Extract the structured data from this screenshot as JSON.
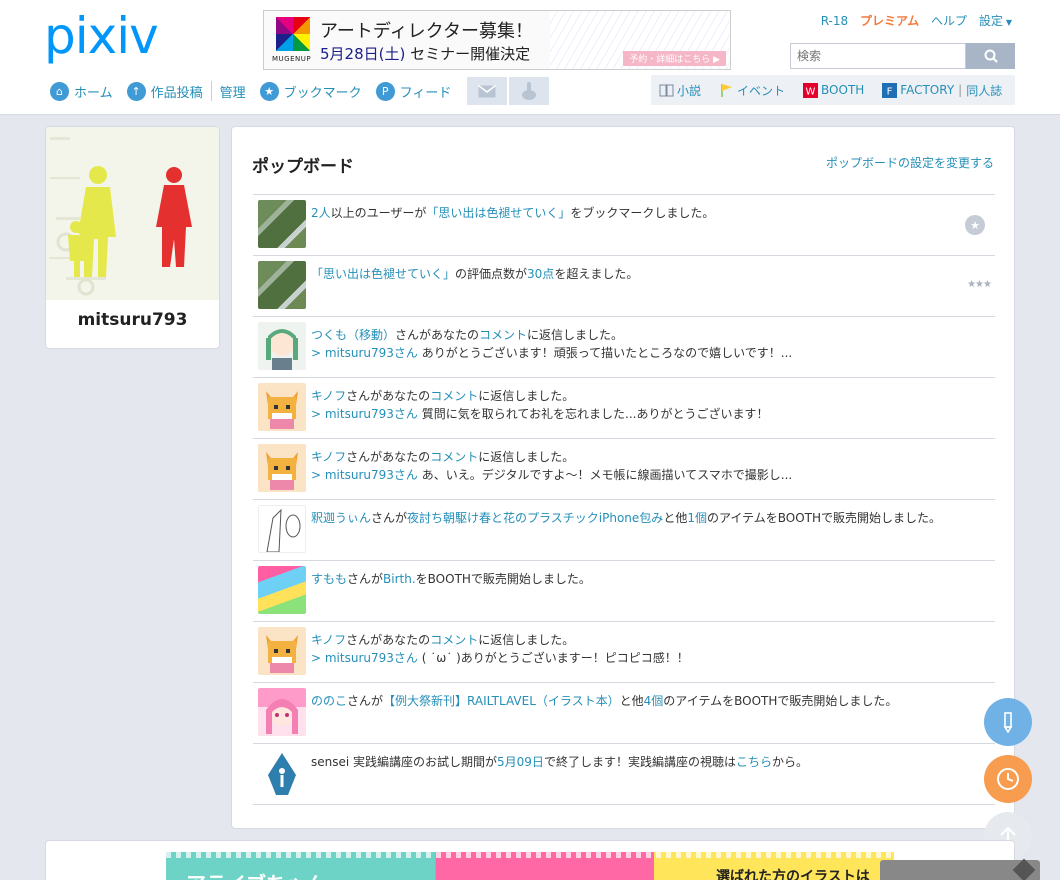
{
  "header": {
    "logo": "pixiv",
    "banner": {
      "brand": "MUGENUP",
      "title": "アートディレクター募集！",
      "date": "5月28日(土)",
      "subtitle": "セミナー開催決定",
      "cta": "予約・詳細はこちら ▶"
    },
    "toplinks": {
      "r18": "R-18",
      "premium": "プレミアム",
      "help": "ヘルプ",
      "settings": "設定"
    },
    "search": {
      "placeholder": "検索"
    },
    "nav": [
      {
        "label": "ホーム"
      },
      {
        "label": "作品投稿"
      },
      {
        "label": "管理"
      },
      {
        "label": "ブックマーク"
      },
      {
        "label": "フィード"
      }
    ],
    "rightnav": {
      "novel": "小説",
      "event": "イベント",
      "booth": "BOOTH",
      "factory": "FACTORY",
      "doujinshi": "同人誌"
    }
  },
  "profile": {
    "username": "mitsuru793"
  },
  "popboard": {
    "title": "ポップボード",
    "settings_link": "ポップボードの設定を変更する",
    "items": [
      {
        "l1a": "2人",
        "l1b": "以上のユーザーが",
        "l1c": "「思い出は色褪せていく」",
        "l1d": "をブックマークしました。"
      },
      {
        "l1a": "「思い出は色褪せていく」",
        "l1b": "の評価点数が",
        "l1c": "30点",
        "l1d": "を超えました。"
      },
      {
        "l1a": "つくも（移動）",
        "l1b": "さんがあなたの",
        "l1c": "コメント",
        "l1d": "に返信しました。",
        "l2a": "> mitsuru793さん",
        "l2b": " ありがとうございます！頑張って描いたところなので嬉しいです！..."
      },
      {
        "l1a": "キノフ",
        "l1b": "さんがあなたの",
        "l1c": "コメント",
        "l1d": "に返信しました。",
        "l2a": "> mitsuru793さん",
        "l2b": " 質問に気を取られてお礼を忘れました...ありがとうございます！"
      },
      {
        "l1a": "キノフ",
        "l1b": "さんがあなたの",
        "l1c": "コメント",
        "l1d": "に返信しました。",
        "l2a": "> mitsuru793さん",
        "l2b": " あ、いえ。デジタルですよ〜！メモ帳に線画描いてスマホで撮影し..."
      },
      {
        "l1a": "釈迦うぃん",
        "l1b": "さんが",
        "l1c": "夜討ち朝駆け春と花のプラスチックiPhone包み",
        "l1d": "と他",
        "l1e": "1個",
        "l1f": "のアイテムをBOOTHで販売開始しました。"
      },
      {
        "l1a": "すもも",
        "l1b": "さんが",
        "l1c": "Birth.",
        "l1d": "をBOOTHで販売開始しました。"
      },
      {
        "l1a": "キノフ",
        "l1b": "さんがあなたの",
        "l1c": "コメント",
        "l1d": "に返信しました。",
        "l2a": "> mitsuru793さん",
        "l2b": " ( ˙ω˙ )ありがとうございますー！ピコピコ感！！"
      },
      {
        "l1a": "ののこ",
        "l1b": "さんが",
        "l1c": "【例大祭新刊】RAILTLAVEL（イラスト本）",
        "l1d": "と他",
        "l1e": "4個",
        "l1f": "のアイテムをBOOTHで販売開始しました。"
      },
      {
        "l1a": "sensei 実践編講座のお試し期間が",
        "l1b": "5月09日",
        "l1c": "で終了します！実践編講座の視聴は",
        "l1d": "こちら",
        "l1e": "から。"
      }
    ]
  },
  "bottom_ad": {
    "left_text": "アライブちゃん",
    "right_text": "選ばれた方のイラストは"
  },
  "colors": {
    "accent": "#0096fa",
    "link": "#258fb8",
    "premium": "#f5793b",
    "pencil_fab": "#70b1e6",
    "clock_fab": "#f89c4f"
  }
}
